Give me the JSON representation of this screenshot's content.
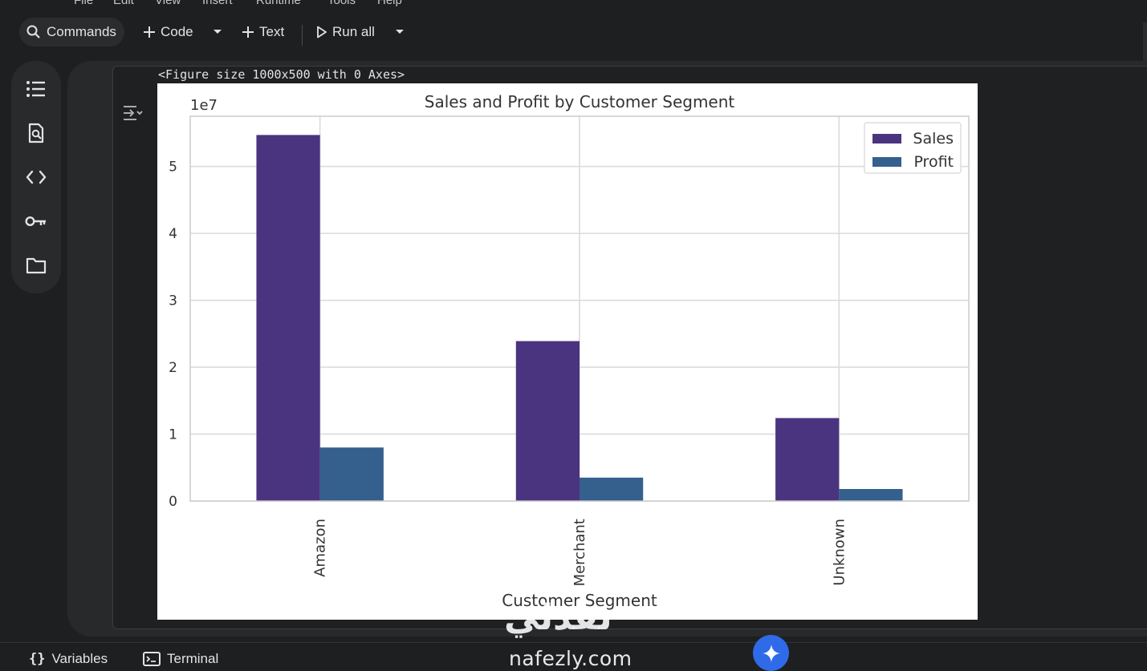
{
  "menu": [
    "File",
    "Edit",
    "View",
    "Insert",
    "Runtime",
    "Tools",
    "Help"
  ],
  "toolbar": {
    "commands_label": "Commands",
    "code_label": "Code",
    "text_label": "Text",
    "run_all_label": "Run all"
  },
  "sidebar": {
    "icons": [
      "table-of-contents-icon",
      "find-replace-icon",
      "code-snippets-icon",
      "secrets-key-icon",
      "files-folder-icon"
    ]
  },
  "output": {
    "figure_text": "<Figure size 1000x500 with 0 Axes>"
  },
  "bottom": {
    "variables_label": "Variables",
    "terminal_label": "Terminal"
  },
  "watermark": {
    "arabic": "نفذلي",
    "english": "nafezly.com"
  },
  "colors": {
    "sales": "#4a3480",
    "profit": "#355f8d",
    "accent": "#2f6ae8"
  },
  "chart_data": {
    "type": "bar",
    "title": "Sales and Profit by Customer Segment",
    "xlabel": "Customer Segment",
    "ylabel": "",
    "offset_label": "1e7",
    "categories": [
      "Amazon",
      "Merchant",
      "Unknown"
    ],
    "series": [
      {
        "name": "Sales",
        "values": [
          54.7,
          23.9,
          12.4
        ]
      },
      {
        "name": "Profit",
        "values": [
          8.0,
          3.5,
          1.8
        ]
      }
    ],
    "yticks": [
      0,
      1,
      2,
      3,
      4,
      5
    ],
    "ylim": [
      0,
      5.75
    ],
    "grid": true,
    "legend": "top-right"
  }
}
